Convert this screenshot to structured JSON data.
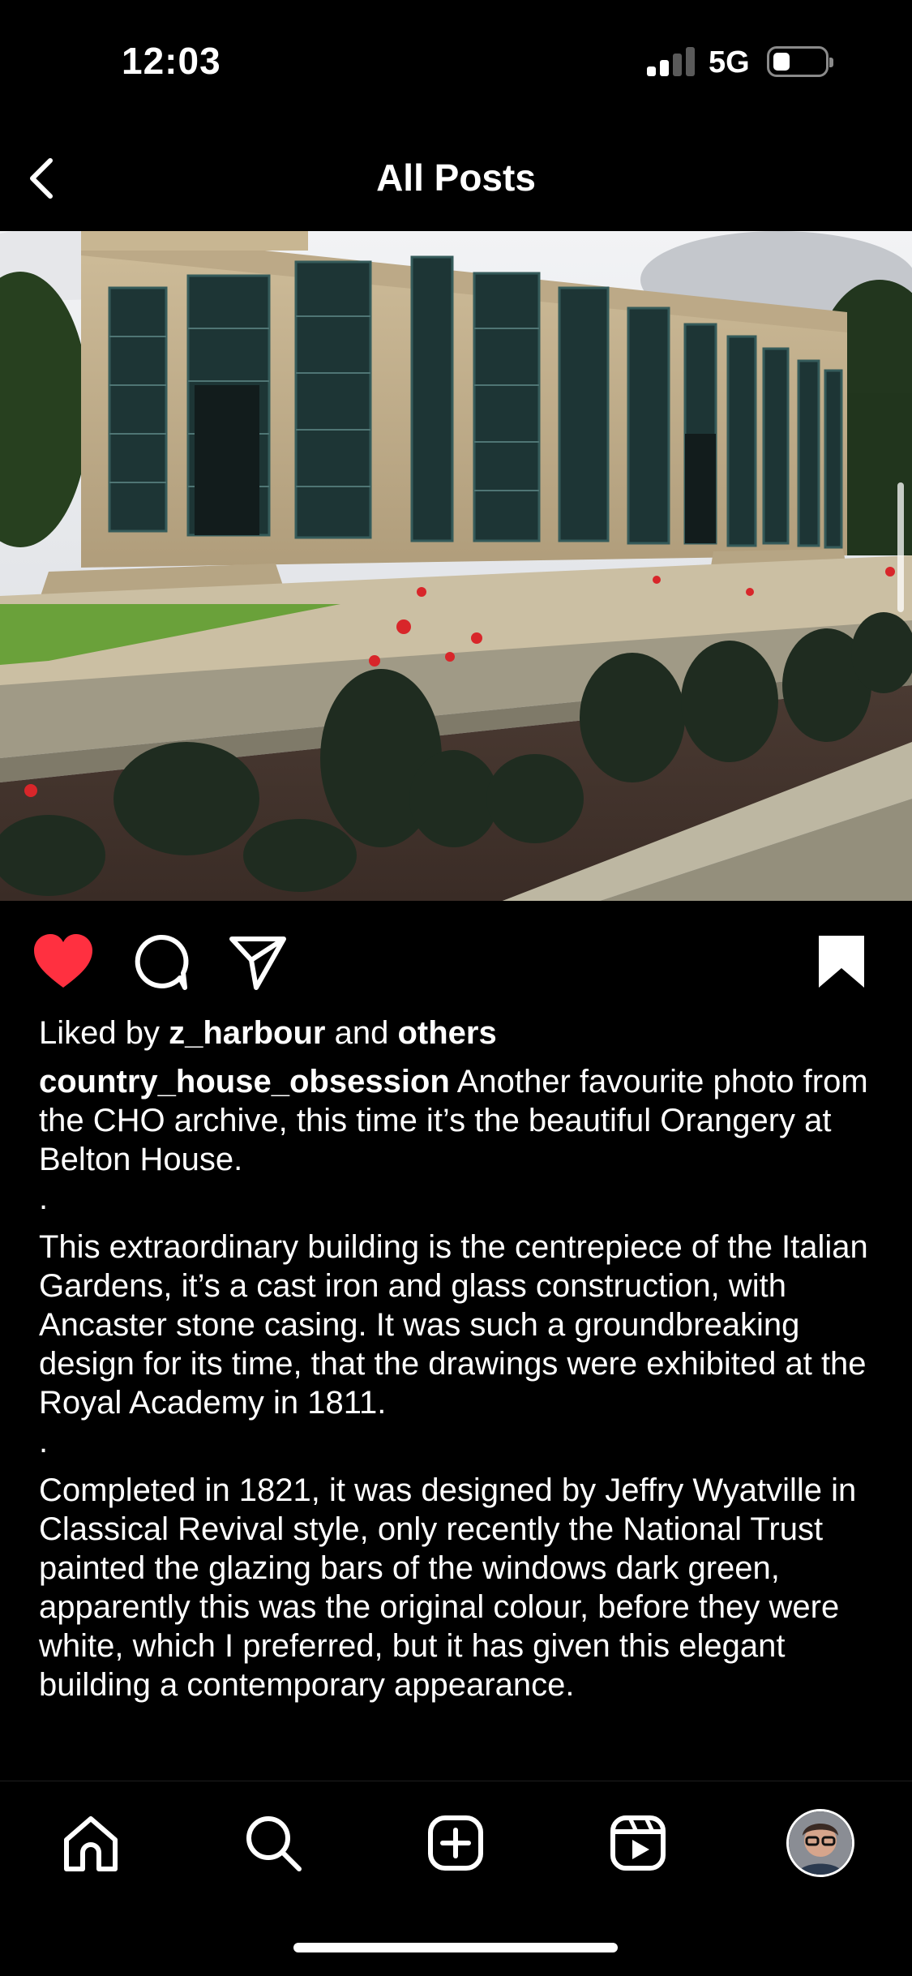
{
  "status_bar": {
    "time": "12:03",
    "network": "5G",
    "signal_bars_active": 2,
    "signal_bars_total": 4,
    "battery_level": 0.2
  },
  "header": {
    "title": "All Posts",
    "back_icon": "chevron-left-icon"
  },
  "post": {
    "liked": true,
    "saved": true,
    "liked_by_prefix": "Liked by ",
    "liked_by_user": "z_harbour",
    "liked_by_and": " and ",
    "liked_by_others": "others",
    "username": "country_house_obsession",
    "caption_lines": [
      " Another favourite photo from the CHO archive, this time it’s the beautiful Orangery at Belton House.",
      ".",
      "This extraordinary building is the centrepiece of the Italian Gardens, it’s a cast iron and glass construction, with Ancaster stone casing. It was such a groundbreaking design for its time, that the drawings were exhibited at the Royal Academy in 1811.",
      ".",
      "Completed in 1821, it was designed by Jeffry Wyatville in Classical Revival style, only recently the National Trust painted the glazing bars of the windows dark green, apparently this was the original colour, before they were white, which I preferred, but it has given this elegant building a contemporary appearance."
    ],
    "icons": [
      "heart-icon",
      "comment-icon",
      "share-icon",
      "bookmark-icon"
    ]
  },
  "bottom_nav": {
    "items": [
      "home-icon",
      "search-icon",
      "create-icon",
      "reels-icon",
      "profile-avatar"
    ]
  },
  "colors": {
    "background": "#000000",
    "text": "#ffffff",
    "like_red": "#ff3040"
  }
}
